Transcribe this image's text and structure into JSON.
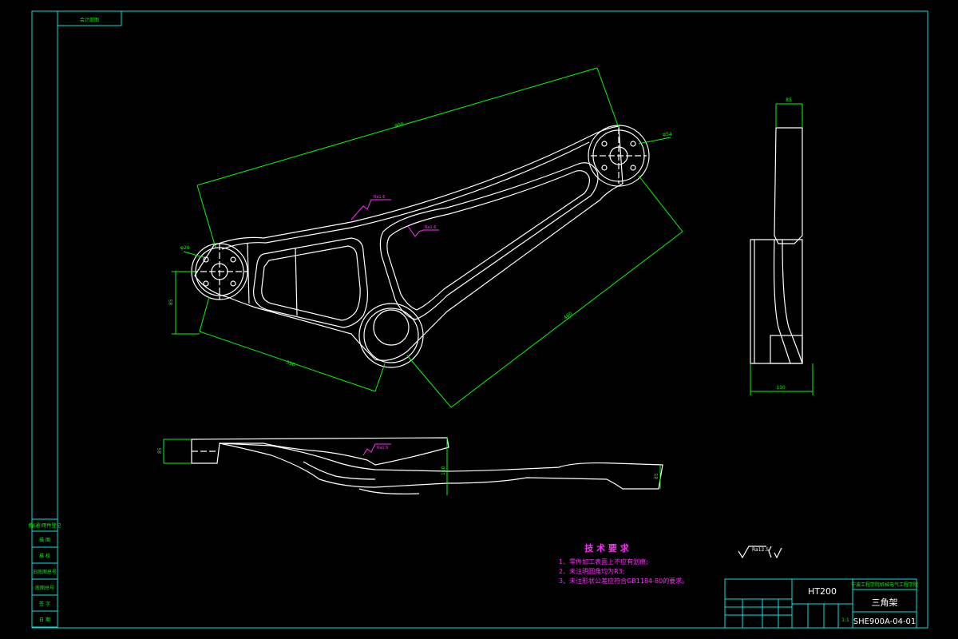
{
  "title_block": {
    "material": "HT200",
    "school": "宁波工程学院机械电气工程学院",
    "part_name": "三角架",
    "drawing_number": "SHE900A-04-01",
    "scale": "1:1"
  },
  "top_left_stamp": "会计部图",
  "tech_requirements": {
    "heading": "技 术 要 求",
    "items": [
      "1、零件加工表面上不应有划痕;",
      "2、未注明圆角均为R3;",
      "3、未注形状公差应符合GB1184-80的要求。"
    ]
  },
  "roughness": {
    "overall": "Ra12.5",
    "marks": [
      "Ra1.6",
      "Ra1.6",
      "Ra1.6"
    ]
  },
  "left_sidebar": [
    "借(通)用件登记",
    "描 图",
    "描 校",
    "旧底图总号",
    "底图总号",
    "签 字",
    "日 期"
  ],
  "dimensions": [
    "900",
    "460",
    "350",
    "85",
    "110",
    "330",
    "φ54",
    "φ20"
  ]
}
